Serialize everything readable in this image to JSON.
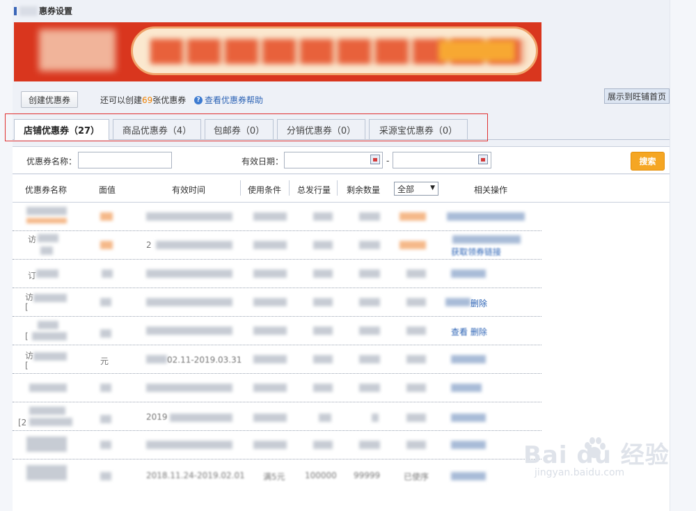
{
  "page": {
    "title": "惠券设置"
  },
  "toolbar": {
    "create_label": "创建优惠券",
    "remain_prefix": "还可以创建",
    "remain_count": "69",
    "remain_suffix": "张优惠券",
    "help_label": "查看优惠券帮助",
    "wangpu_label": "展示到旺铺首页"
  },
  "tabs": [
    {
      "label": "店铺优惠券（27）",
      "active": true
    },
    {
      "label": "商品优惠券（4）",
      "active": false
    },
    {
      "label": "包邮券（0）",
      "active": false
    },
    {
      "label": "分销优惠券（0）",
      "active": false
    },
    {
      "label": "采源宝优惠券（0）",
      "active": false
    }
  ],
  "filters": {
    "name_label": "优惠券名称：",
    "name_value": "",
    "date_label": "有效日期：",
    "date_start": "",
    "date_end": "",
    "separator": "-",
    "search_label": "搜索"
  },
  "table": {
    "headers": [
      "优惠券名称",
      "面值",
      "有效时间",
      "使用条件",
      "总发行量",
      "剩余数量",
      "相关操作"
    ],
    "status_filter": "全部",
    "visible_fragments": {
      "r2_name": "访",
      "r2_time": "2",
      "r2_op": "获取领券链接",
      "r3_name": "订",
      "r4_name": "访",
      "r4_name2": "[",
      "r4_op": "删除",
      "r5_name": "[",
      "r5_op": "查看 删除",
      "r6_name": "访",
      "r6_name2": "[",
      "r6_face": "元",
      "r6_time": "02.11-2019.03.31",
      "r8_name": "[2",
      "r8_time": "2019",
      "r10_time": "2018.11.24-2019.02.01",
      "r10_cond": "满5元",
      "r10_total": "100000",
      "r10_remain": "99999",
      "r10_status": "已使序"
    }
  },
  "watermark": {
    "brand": "Bai du 经验",
    "url": "jingyan.baidu.com"
  },
  "colors": {
    "accent_orange": "#f5a623",
    "link_blue": "#2c63b5",
    "banner_red": "#d9361e",
    "highlight_red": "#e03030"
  }
}
